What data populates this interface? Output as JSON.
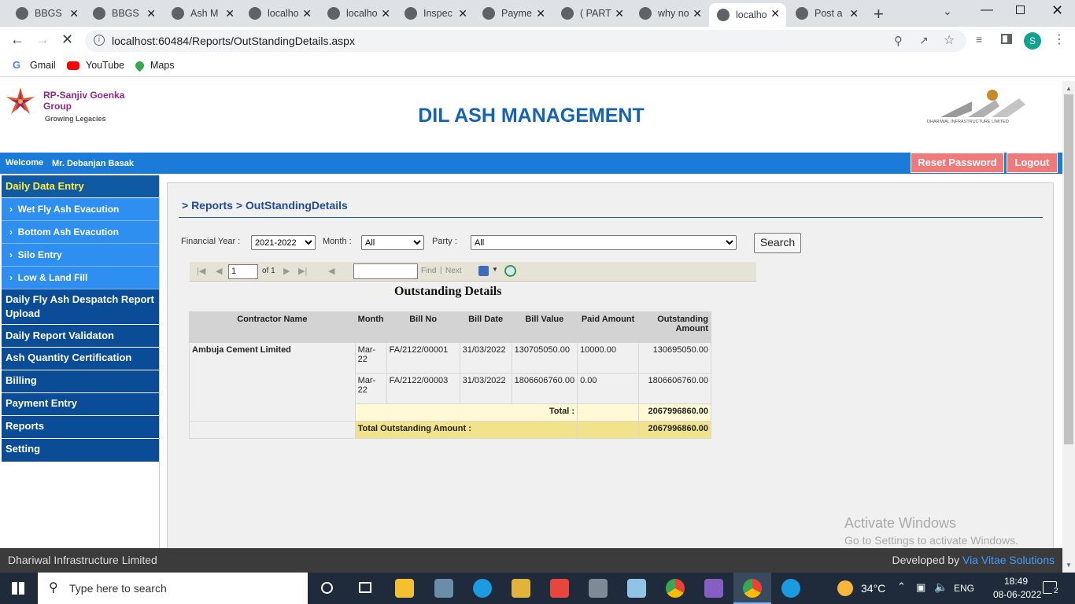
{
  "browser": {
    "tabs": [
      {
        "title": "BBGS",
        "active": false
      },
      {
        "title": "BBGS",
        "active": false
      },
      {
        "title": "Ash M",
        "active": false
      },
      {
        "title": "localho",
        "active": false
      },
      {
        "title": "localho",
        "active": false
      },
      {
        "title": "Inspec",
        "active": false
      },
      {
        "title": "Payme",
        "active": false
      },
      {
        "title": "( PART",
        "active": false
      },
      {
        "title": "why no",
        "active": false
      },
      {
        "title": "localho",
        "active": true
      },
      {
        "title": "Post a",
        "active": false
      }
    ],
    "url": "localhost:60484/Reports/OutStandingDetails.aspx",
    "profile_initial": "S",
    "bookmarks": [
      {
        "label": "Gmail",
        "icon": "gmail-icon"
      },
      {
        "label": "YouTube",
        "icon": "youtube-icon"
      },
      {
        "label": "Maps",
        "icon": "maps-icon"
      }
    ]
  },
  "header": {
    "logo_line1": "RP-Sanjiv Goenka",
    "logo_line2": "Group",
    "logo_tagline": "Growing Legacies",
    "title": "DIL ASH MANAGEMENT",
    "right_logo_text": "DHARIWAL INFRASTRUCTURE LIMITED"
  },
  "userbar": {
    "welcome": "Welcome",
    "user": "Mr. Debanjan Basak",
    "reset_password": "Reset Password",
    "logout": "Logout"
  },
  "sidebar": {
    "items": [
      {
        "label": "Daily Data Entry",
        "type": "header"
      },
      {
        "label": "Wet Fly Ash Evacution",
        "type": "sub"
      },
      {
        "label": "Bottom Ash Evacution",
        "type": "sub"
      },
      {
        "label": "Silo Entry",
        "type": "sub"
      },
      {
        "label": "Low & Land Fill",
        "type": "sub"
      },
      {
        "label": "Daily Fly Ash Despatch Report Upload",
        "type": "nav"
      },
      {
        "label": "Daily Report Validaton",
        "type": "nav"
      },
      {
        "label": "Ash Quantity Certification",
        "type": "nav"
      },
      {
        "label": "Billing",
        "type": "nav"
      },
      {
        "label": "Payment Entry",
        "type": "nav"
      },
      {
        "label": "Reports",
        "type": "nav"
      },
      {
        "label": "Setting",
        "type": "nav"
      }
    ]
  },
  "breadcrumb": "> Reports > OutStandingDetails",
  "filters": {
    "fy_label": "Financial Year :",
    "fy_value": "2021-2022",
    "month_label": "Month :",
    "month_value": "All",
    "party_label": "Party :",
    "party_value": "All",
    "search_label": "Search"
  },
  "viewer": {
    "page_value": "1",
    "of_text": "of 1",
    "find_label": "Find",
    "next_label": "Next"
  },
  "report": {
    "title": "Outstanding Details",
    "columns": [
      "Contractor Name",
      "Month",
      "Bill No",
      "Bill Date",
      "Bill Value",
      "Paid Amount",
      "Outstanding Amount"
    ],
    "contractor": "Ambuja Cement Limited",
    "rows": [
      {
        "month": "Mar-22",
        "bill_no": "FA/2122/00001",
        "bill_date": "31/03/2022",
        "bill_value": "130705050.00",
        "paid": "10000.00",
        "outstanding": "130695050.00"
      },
      {
        "month": "Mar-22",
        "bill_no": "FA/2122/00003",
        "bill_date": "31/03/2022",
        "bill_value": "1806606760.00",
        "paid": "0.00",
        "outstanding": "1806606760.00"
      }
    ],
    "total_label": "Total :",
    "total_value": "2067996860.00",
    "grand_total_label": "Total Outstanding Amount :",
    "grand_total_value": "2067996860.00"
  },
  "watermark": {
    "line1": "Activate Windows",
    "line2": "Go to Settings to activate Windows."
  },
  "footer": {
    "left": "Dhariwal Infrastructure Limited",
    "right_prefix": "Developed by",
    "right_link": "Via Vitae Solutions"
  },
  "taskbar": {
    "search_placeholder": "Type here to search",
    "temperature": "34°C",
    "language": "ENG",
    "time": "18:49",
    "date": "08-06-2022",
    "notifications": "2"
  }
}
